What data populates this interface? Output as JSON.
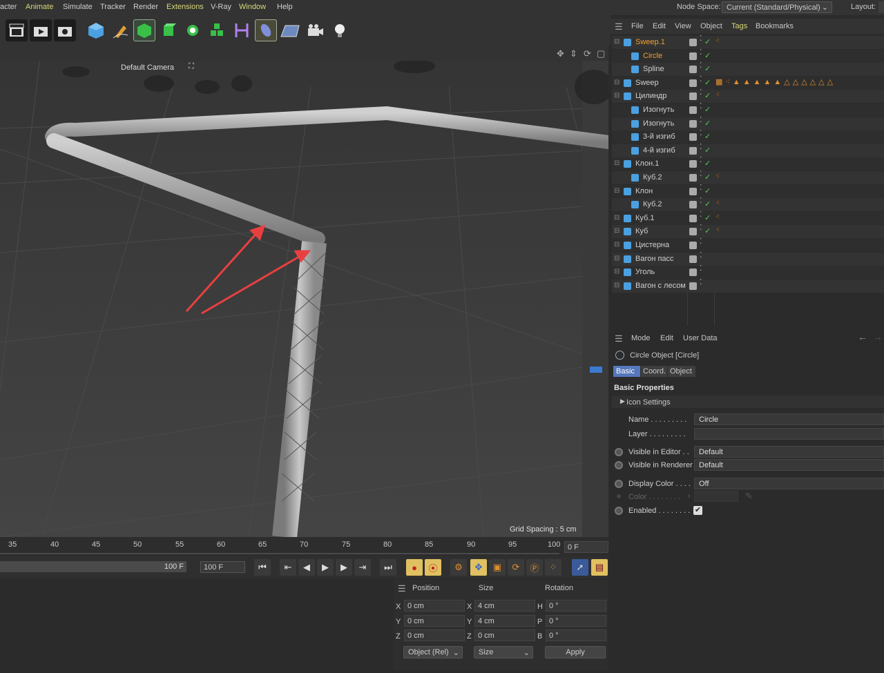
{
  "menubar": {
    "items": [
      "acter",
      "Animate",
      "Simulate",
      "Tracker",
      "Render",
      "Extensions",
      "V-Ray",
      "Window",
      "Help"
    ],
    "node_space_label": "Node Space:",
    "node_space_value": "Current (Standard/Physical)",
    "layout_label": "Layout:"
  },
  "viewport": {
    "camera": "Default Camera",
    "grid_spacing": "Grid Spacing : 5 cm"
  },
  "timeline": {
    "ticks": [
      "35",
      "40",
      "45",
      "50",
      "55",
      "60",
      "65",
      "70",
      "75",
      "80",
      "85",
      "90",
      "95",
      "100"
    ],
    "current_frame": "0 F",
    "end_frame": "100 F",
    "max_frame": "100 F"
  },
  "coords": {
    "headers": {
      "position": "Position",
      "size": "Size",
      "rotation": "Rotation"
    },
    "rows": [
      {
        "axis": "X",
        "pos": "0 cm",
        "size_axis": "X",
        "size": "4 cm",
        "rot_axis": "H",
        "rot": "0 °"
      },
      {
        "axis": "Y",
        "pos": "0 cm",
        "size_axis": "Y",
        "size": "4 cm",
        "rot_axis": "P",
        "rot": "0 °"
      },
      {
        "axis": "Z",
        "pos": "0 cm",
        "size_axis": "Z",
        "size": "0 cm",
        "rot_axis": "B",
        "rot": "0 °"
      }
    ],
    "mode_select": "Object (Rel)",
    "size_select": "Size",
    "apply": "Apply"
  },
  "object_manager": {
    "menu": [
      "File",
      "Edit",
      "View",
      "Object",
      "Tags",
      "Bookmarks"
    ],
    "objects": [
      {
        "name": "Sweep.1",
        "indent": 0,
        "selected": true
      },
      {
        "name": "Circle",
        "indent": 1,
        "selected": true
      },
      {
        "name": "Spline",
        "indent": 1,
        "selected": false
      },
      {
        "name": "Sweep",
        "indent": 0,
        "selected": false
      },
      {
        "name": "Цилиндр",
        "indent": 0,
        "selected": false
      },
      {
        "name": "Изогнуть",
        "indent": 1,
        "selected": false
      },
      {
        "name": "Изогнуть",
        "indent": 1,
        "selected": false
      },
      {
        "name": "3-й изгиб",
        "indent": 1,
        "selected": false
      },
      {
        "name": "4-й изгиб",
        "indent": 1,
        "selected": false
      },
      {
        "name": "Клон.1",
        "indent": 0,
        "selected": false
      },
      {
        "name": "Куб.2",
        "indent": 1,
        "selected": false
      },
      {
        "name": "Клон",
        "indent": 0,
        "selected": false
      },
      {
        "name": "Куб.2",
        "indent": 1,
        "selected": false
      },
      {
        "name": "Куб.1",
        "indent": 0,
        "selected": false
      },
      {
        "name": "Куб",
        "indent": 0,
        "selected": false
      },
      {
        "name": "Цистерна",
        "indent": 0,
        "selected": false
      },
      {
        "name": "Вагон пасс",
        "indent": 0,
        "selected": false
      },
      {
        "name": "Уголь",
        "indent": 0,
        "selected": false
      },
      {
        "name": "Вагон с лесом",
        "indent": 0,
        "selected": false
      }
    ]
  },
  "attributes": {
    "menu": [
      "Mode",
      "Edit",
      "User Data"
    ],
    "title": "Circle Object [Circle]",
    "tabs": [
      "Basic",
      "Coord.",
      "Object"
    ],
    "section": "Basic Properties",
    "icon_settings": "Icon Settings",
    "name_label": "Name . . . . . . . . .",
    "name_value": "Circle",
    "layer_label": "Layer . . . . . . . . .",
    "vis_editor_label": "Visible in Editor . .",
    "vis_editor_value": "Default",
    "vis_render_label": "Visible in Renderer",
    "vis_render_value": "Default",
    "display_color_label": "Display Color . . . .",
    "display_color_value": "Off",
    "color_label": "Color . . . . . . . .",
    "enabled_label": "Enabled . . . . . . . ."
  },
  "colors": {
    "accent": "#f0a030",
    "selection_tab": "#5577bb"
  }
}
